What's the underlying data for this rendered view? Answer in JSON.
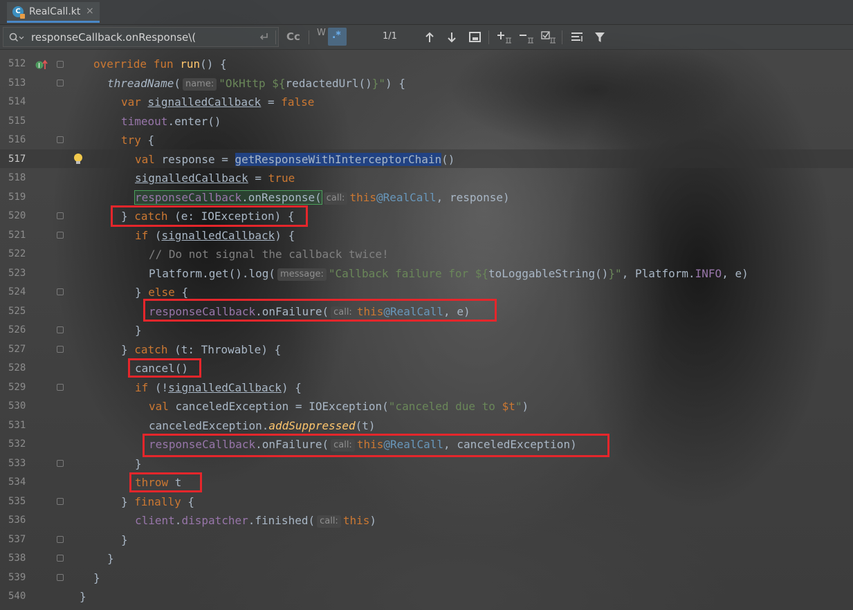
{
  "tab": {
    "filename": "RealCall.kt",
    "icon": "kotlin-class-icon",
    "close": "×"
  },
  "search": {
    "query": "responseCallback.onResponse\\(",
    "match_count": "1/1",
    "case_toggle": "Cc",
    "regex_toggle": ".*"
  },
  "editor": {
    "current_line": "517",
    "line_numbers": [
      "512",
      "513",
      "514",
      "515",
      "516",
      "517",
      "518",
      "519",
      "520",
      "521",
      "522",
      "523",
      "524",
      "525",
      "526",
      "527",
      "528",
      "529",
      "530",
      "531",
      "532",
      "533",
      "534",
      "535",
      "536",
      "537",
      "538",
      "539",
      "540"
    ],
    "hints": {
      "name": "name:",
      "call": "call:",
      "message": "message:"
    },
    "tokens": {
      "override": "override",
      "fun": "fun",
      "run": "run",
      "paren_brace": "() {",
      "threadName": "threadName",
      "paren_open": "(",
      "okhttp_str": "\"OkHttp ${",
      "redactedUrl": "redactedUrl()",
      "str_close": "}\"",
      "close_brace_open": ") {",
      "var": "var",
      "signalledCallback": "signalledCallback",
      "eq": " = ",
      "false": "false",
      "timeout": "timeout",
      "enter": ".enter()",
      "try": "try",
      "brace_open": " {",
      "val": "val",
      "response_eq": " response = ",
      "getResponse": "getResponseWithInterceptorChain",
      "parens": "()",
      "true": "true",
      "responseCallback": "responseCallback",
      "onResponse": ".onResponse(",
      "this": "this",
      "atRealCall": "@RealCall",
      "comma_response": ", response)",
      "close_brace": "}",
      "catch": "catch",
      "ioexc_params": " (e: IOException) {",
      "if": "if",
      "if_open": " (",
      "close_paren_brace": ") {",
      "comment": "// Do not signal the callback twice!",
      "platform_get_log": "Platform.get().log(",
      "cb_failure_str": "\"Callback failure for ${",
      "toLoggable": "toLoggableString()",
      "platform_info_pre": ", Platform.",
      "INFO": "INFO",
      "e_close": ", e)",
      "else": "else",
      "onFailure": ".onFailure(",
      "comma_e": ", e)",
      "throwable_params": " (t: Throwable) {",
      "cancel": "cancel()",
      "if_not": " (!",
      "canceledException_eq": " canceledException = IOException(",
      "canceled_str_a": "\"canceled due to ",
      "dollar_t": "$t",
      "canceled_str_b": "\"",
      "close_paren": ")",
      "canceledException_dot": "canceledException.",
      "addSuppressed": "addSuppressed",
      "t_paren": "(t)",
      "comma_canceled": ", canceledException)",
      "throw": "throw",
      "t": " t",
      "finally": "finally",
      "client": "client",
      "dot": ".",
      "dispatcher": "dispatcher",
      "finished": ".finished(",
      "this_close": ")"
    }
  }
}
